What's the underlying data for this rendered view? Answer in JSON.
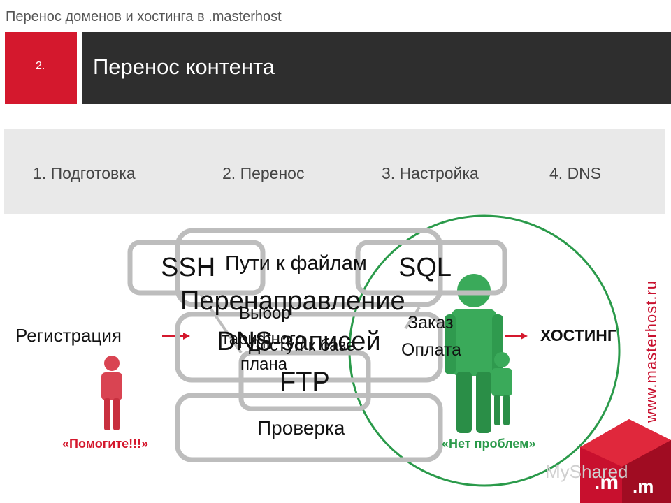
{
  "header": {
    "top_title": "Перенос доменов и хостинга в .masterhost",
    "slide_number": "2.",
    "slide_title": "Перенос контента"
  },
  "steps": [
    "1. Подготовка",
    "2. Перенос",
    "3. Настройка",
    "4. DNS"
  ],
  "diagram": {
    "left_label": "Регистрация",
    "right_label": "ХОСТИНГ",
    "boxes": {
      "ssh": "SSH",
      "paths": "Пути к файлам",
      "sql": "SQL",
      "redirect": "Перенаправление",
      "choose_line1": "Выбор",
      "choose_line2": "тарифного",
      "choose_line3": "плана",
      "dns_records": "DNS-записей",
      "order": "Заказ",
      "payment": "Оплата",
      "access": "Доступ к базе",
      "ftp": "FTP",
      "check": "Проверка"
    },
    "quote_left": "«Помогите!!!»",
    "quote_right": "«Нет проблем»"
  },
  "colors": {
    "brand_red": "#d4182d",
    "dark": "#2e2e2e",
    "green": "#2a9a4a"
  },
  "side_url": "www.masterhost.ru",
  "watermark": "MyShared"
}
